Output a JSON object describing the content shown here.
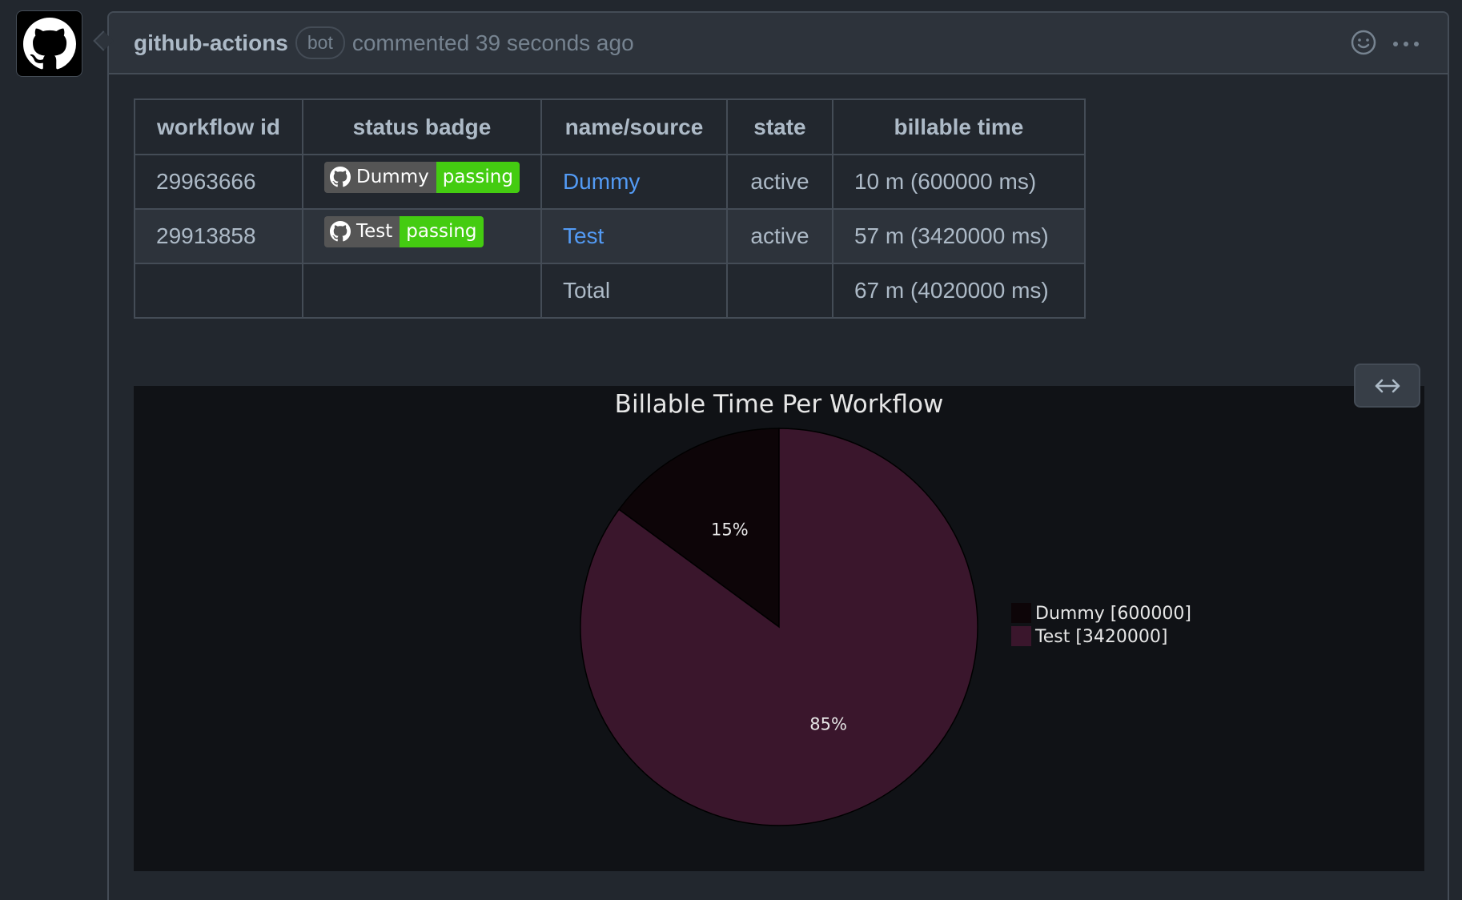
{
  "comment": {
    "author": "github-actions",
    "badge": "bot",
    "meta": "commented 39 seconds ago"
  },
  "table": {
    "headers": [
      "workflow id",
      "status badge",
      "name/source",
      "state",
      "billable time"
    ],
    "rows": [
      {
        "id": "29963666",
        "badge_label": "Dummy",
        "badge_status": "passing",
        "name": "Dummy",
        "state": "active",
        "time": "10 m (600000 ms)"
      },
      {
        "id": "29913858",
        "badge_label": "Test",
        "badge_status": "passing",
        "name": "Test",
        "state": "active",
        "time": "57 m (3420000 ms)"
      }
    ],
    "total": {
      "label": "Total",
      "time": "67 m (4020000 ms)"
    }
  },
  "chart_data": {
    "type": "pie",
    "title": "Billable Time Per Workflow",
    "labels": [
      "Dummy",
      "Test"
    ],
    "values": [
      600000,
      3420000
    ],
    "percent_labels": [
      "15%",
      "85%"
    ],
    "legend": [
      "Dummy [600000]",
      "Test [3420000]"
    ],
    "legend_position": "right",
    "colors": [
      "#0d0508",
      "#3a162c"
    ]
  },
  "icons": {
    "avatar": "github-mark-icon",
    "emoji": "smiley-icon",
    "menu": "kebab-horizontal-icon",
    "expand": "arrow-both-icon"
  }
}
